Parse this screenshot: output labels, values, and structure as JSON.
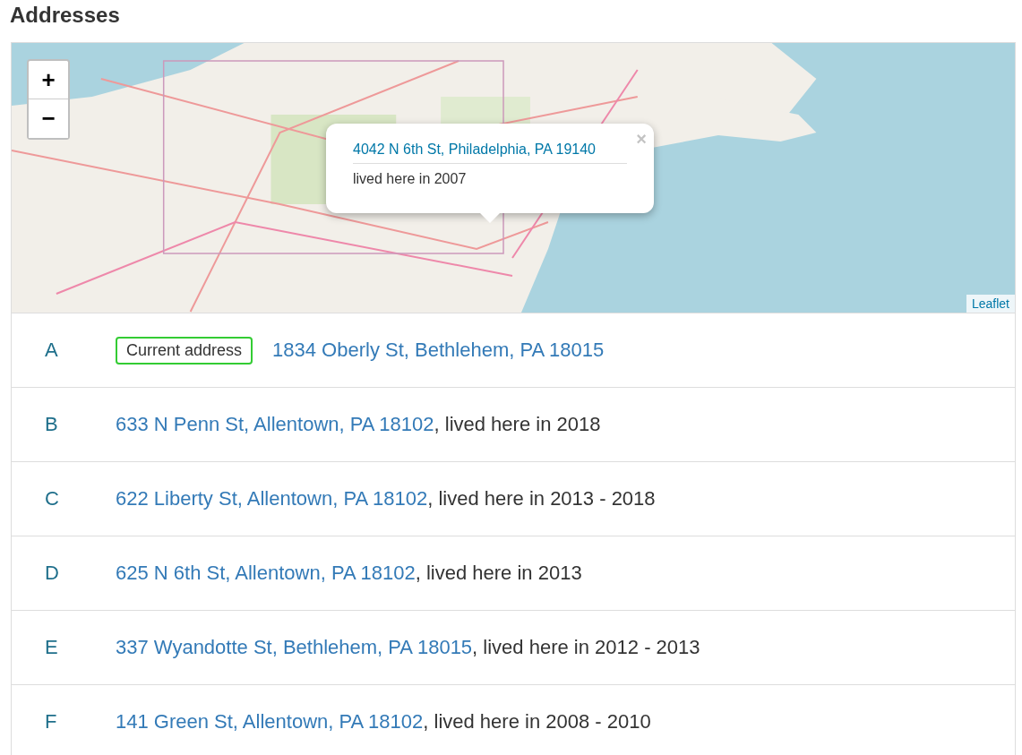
{
  "title": "Addresses",
  "map": {
    "kind": "picture",
    "zoom_in": "+",
    "zoom_out": "−",
    "popup": {
      "link": "4042 N 6th St, Philadelphia, PA 19140",
      "note": "lived here in 2007",
      "close": "×"
    },
    "attribution": "Leaflet"
  },
  "addresses": [
    {
      "marker": "A",
      "badge": "Current address",
      "address": "1834 Oberly St, Bethlehem, PA 18015"
    },
    {
      "marker": "B",
      "address": "633 N Penn St, Allentown, PA 18102",
      "period": ", lived here in 2018"
    },
    {
      "marker": "C",
      "address": "622 Liberty St, Allentown, PA 18102",
      "period": ", lived here in 2013 - 2018"
    },
    {
      "marker": "D",
      "address": "625 N 6th St, Allentown, PA 18102",
      "period": ", lived here in 2013"
    },
    {
      "marker": "E",
      "address": "337 Wyandotte St, Bethlehem, PA 18015",
      "period": ", lived here in 2012 - 2013"
    },
    {
      "marker": "F",
      "address": "141 Green St, Allentown, PA 18102",
      "period": ", lived here in 2008 - 2010"
    }
  ]
}
